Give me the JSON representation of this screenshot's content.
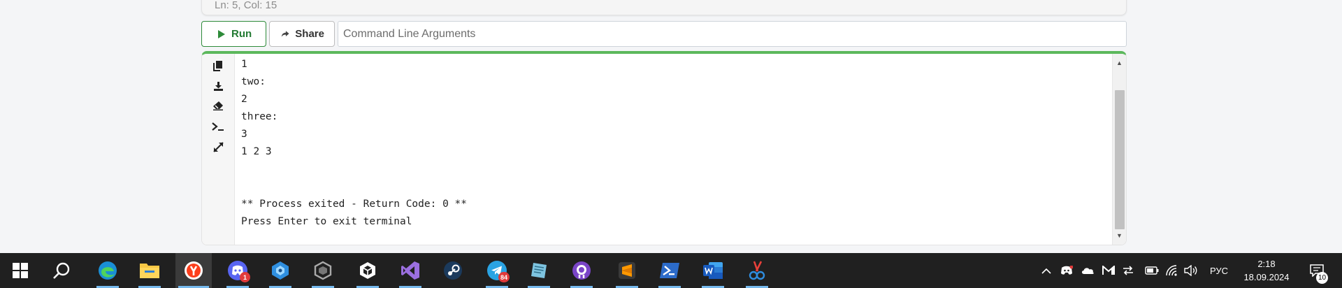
{
  "editor": {
    "cursor_position": "Ln: 5,  Col: 15"
  },
  "toolbar": {
    "run_label": "Run",
    "share_label": "Share",
    "args_placeholder": "Command Line Arguments",
    "run_color": "#2e8b3a"
  },
  "terminal": {
    "accent_color": "#5cb85c",
    "tools": [
      "copy-icon",
      "download-icon",
      "eraser-icon",
      "terminal-icon",
      "expand-icon"
    ],
    "lines": [
      "1",
      "two:",
      "2",
      "three:",
      "3",
      "1 2 3",
      "",
      "",
      "** Process exited - Return Code: 0 **",
      "Press Enter to exit terminal"
    ]
  },
  "taskbar": {
    "apps": [
      {
        "name": "start-icon"
      },
      {
        "name": "search-icon"
      },
      {
        "name": "edge-icon"
      },
      {
        "name": "file-explorer-icon"
      },
      {
        "name": "yandex-browser-icon"
      },
      {
        "name": "discord-icon",
        "badge": "1"
      },
      {
        "name": "app-cube-icon"
      },
      {
        "name": "app-hexagon-icon"
      },
      {
        "name": "unity-icon"
      },
      {
        "name": "visual-studio-icon"
      },
      {
        "name": "steam-icon"
      },
      {
        "name": "telegram-icon",
        "badge": "84"
      },
      {
        "name": "notes-app-icon"
      },
      {
        "name": "github-desktop-icon"
      },
      {
        "name": "sublime-text-icon"
      },
      {
        "name": "powershell-icon"
      },
      {
        "name": "word-icon"
      },
      {
        "name": "snipping-tool-icon"
      }
    ],
    "tray": {
      "language": "РУС",
      "time": "2:18",
      "date": "18.09.2024",
      "notifications": "10"
    }
  }
}
